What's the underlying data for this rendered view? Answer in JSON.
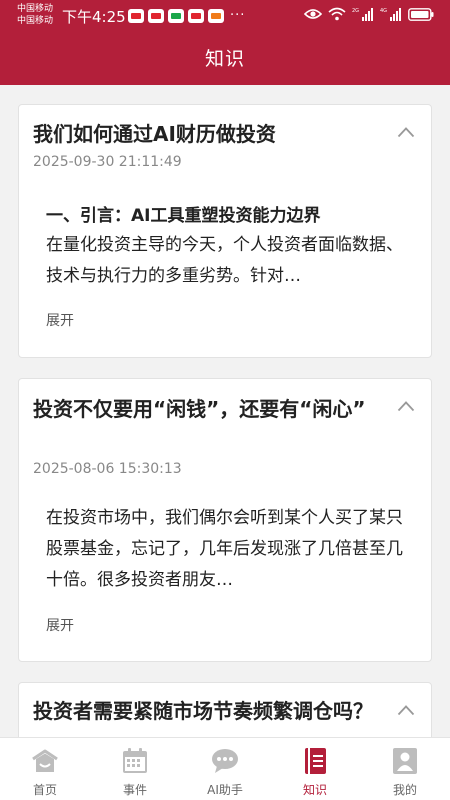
{
  "status_bar": {
    "carrier_1": "中国移动",
    "carrier_2": "中国移动",
    "time": "下午4:25",
    "more_indicator": "···",
    "signal_labels": [
      "2G",
      "4G"
    ]
  },
  "header": {
    "title": "知识",
    "background_color": "#b31f3a"
  },
  "articles": [
    {
      "title": "我们如何通过AI财历做投资",
      "date": "2025-09-30 21:11:49",
      "heading": "一、引言：AI工具重塑投资能力边界",
      "body": "在量化投资主导的今天，个人投资者面临数据、技术与执行力的多重劣势。针对…",
      "expand_label": "展开",
      "collapse_icon": "chevron-up-icon"
    },
    {
      "title": "投资不仅要用“闲钱”，还要有“闲心”",
      "date": "2025-08-06 15:30:13",
      "body": "在投资市场中，我们偶尔会听到某个人买了某只股票基金，忘记了，几年后发现涨了几倍甚至几十倍。很多投资者朋友…",
      "expand_label": "展开",
      "collapse_icon": "chevron-up-icon"
    },
    {
      "title": "投资者需要紧随市场节奏频繁调仓吗？",
      "collapse_icon": "chevron-up-icon"
    }
  ],
  "bottom_nav": [
    {
      "label": "首页",
      "icon": "home-icon",
      "active": false
    },
    {
      "label": "事件",
      "icon": "calendar-icon",
      "active": false
    },
    {
      "label": "AI助手",
      "icon": "chat-bubble-icon",
      "active": false
    },
    {
      "label": "知识",
      "icon": "notebook-icon",
      "active": true
    },
    {
      "label": "我的",
      "icon": "profile-icon",
      "active": false
    }
  ],
  "colors": {
    "accent": "#b31f3a",
    "inactive_icon": "#bdbdbd",
    "text_primary": "#222222",
    "text_secondary": "#888888"
  }
}
